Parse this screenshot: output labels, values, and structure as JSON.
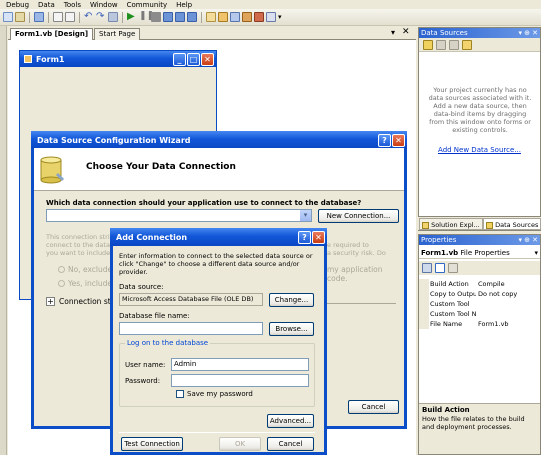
{
  "menu": [
    "Debug",
    "Data",
    "Tools",
    "Window",
    "Community",
    "Help"
  ],
  "doc_tabs": {
    "active": "Form1.vb [Design]",
    "other": "Start Page"
  },
  "designer_form": {
    "title": "Form1"
  },
  "wizard": {
    "title": "Data Source Configuration Wizard",
    "heading": "Choose Your Data Connection",
    "question": "Which data connection should your application use to connect to the database?",
    "new_connection": "New Connection...",
    "info_left": "This connection stri\nconnect to the data\nyou want to include",
    "info_right": "e required to\na security risk. Do",
    "radio_no": "No, exclude",
    "radio_yes": "Yes, include",
    "radio_right": "my application code.",
    "conn_string": "Connection strin",
    "cancel": "Cancel"
  },
  "dialog": {
    "title": "Add Connection",
    "intro": "Enter information to connect to the selected data source or click \"Change\" to choose a different data source and/or provider.",
    "ds_label": "Data source:",
    "ds_value": "Microsoft Access Database File (OLE DB)",
    "change": "Change...",
    "file_label": "Database file name:",
    "file_value": "",
    "browse": "Browse...",
    "logon": "Log on to the database",
    "user_label": "User name:",
    "user_value": "Admin",
    "pwd_label": "Password:",
    "pwd_value": "",
    "save_pwd": "Save my password",
    "advanced": "Advanced...",
    "test": "Test Connection",
    "ok": "OK",
    "cancel": "Cancel"
  },
  "data_sources": {
    "title": "Data Sources",
    "message": "Your project currently has no data sources associated with it. Add a new data source, then data-bind items by dragging from this window onto forms or existing controls.",
    "link": "Add New Data Source..."
  },
  "bottom_tabs": {
    "solution": "Solution Expl...",
    "datasources": "Data Sources"
  },
  "properties": {
    "title": "Properties",
    "object": "Form1.vb",
    "object_type": "File Properties",
    "rows": [
      {
        "name": "Build Action",
        "value": "Compile"
      },
      {
        "name": "Copy to Outpu",
        "value": "Do not copy"
      },
      {
        "name": "Custom Tool",
        "value": ""
      },
      {
        "name": "Custom Tool Na",
        "value": ""
      },
      {
        "name": "File Name",
        "value": "Form1.vb"
      }
    ],
    "desc_title": "Build Action",
    "desc_text": "How the file relates to the build and deployment processes."
  }
}
